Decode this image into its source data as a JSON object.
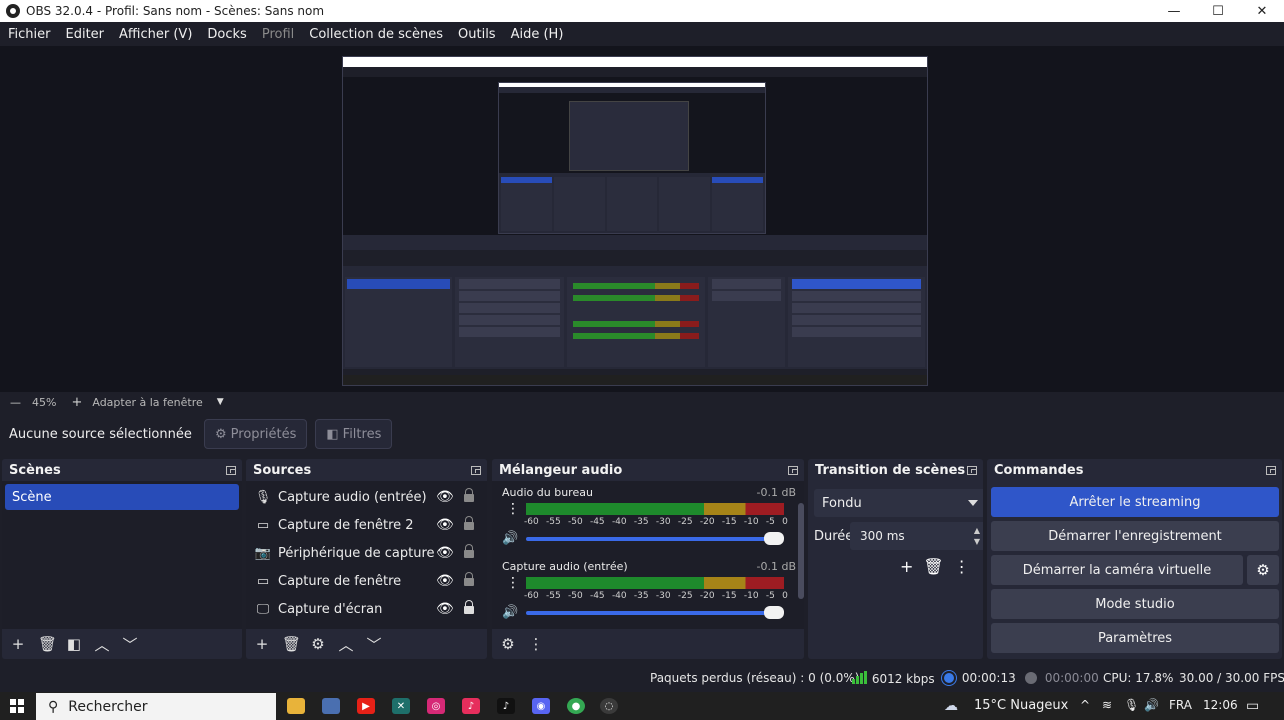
{
  "window": {
    "title": "OBS 32.0.4 - Profil: Sans nom - Scènes: Sans nom",
    "minimize": "—",
    "maximize": "☐",
    "close": "✕"
  },
  "menu": {
    "items": [
      "Fichier",
      "Editer",
      "Afficher (V)",
      "Docks",
      "Profil",
      "Collection de scènes",
      "Outils",
      "Aide (H)"
    ]
  },
  "zoom": {
    "minus": "—",
    "value": "45%",
    "plus": "+",
    "fit": "Adapter à la fenêtre"
  },
  "context": {
    "no_source": "Aucune source sélectionnée",
    "properties": "Propriétés",
    "filters": "Filtres"
  },
  "scenes": {
    "title": "Scènes",
    "items": [
      "Scène"
    ]
  },
  "sources": {
    "title": "Sources",
    "items": [
      {
        "name": "Capture audio (entrée)",
        "icon": "microphone-icon",
        "locked": false
      },
      {
        "name": "Capture de fenêtre 2",
        "icon": "window-icon",
        "locked": false
      },
      {
        "name": "Périphérique de capture vid",
        "icon": "camera-icon",
        "locked": false
      },
      {
        "name": "Capture de fenêtre",
        "icon": "window-icon",
        "locked": false
      },
      {
        "name": "Capture d'écran",
        "icon": "monitor-icon",
        "locked": true
      }
    ]
  },
  "mixer": {
    "title": "Mélangeur audio",
    "channels": [
      {
        "name": "Audio du bureau",
        "db": "-0.1 dB",
        "volume": 1.0
      },
      {
        "name": "Capture audio (entrée)",
        "db": "-0.1 dB",
        "volume": 1.0
      }
    ],
    "ticks": [
      "-60",
      "-55",
      "-50",
      "-45",
      "-40",
      "-35",
      "-30",
      "-25",
      "-20",
      "-15",
      "-10",
      "-5",
      "0"
    ]
  },
  "transition": {
    "title": "Transition de scènes",
    "selected": "Fondu",
    "duration_label": "Durée",
    "duration_value": "300 ms"
  },
  "commands": {
    "title": "Commandes",
    "stop_streaming": "Arrêter le streaming",
    "start_recording": "Démarrer l'enregistrement",
    "start_virtual_cam": "Démarrer la caméra virtuelle",
    "studio_mode": "Mode studio",
    "settings": "Paramètres"
  },
  "status": {
    "dropped": "Paquets perdus (réseau) : 0 (0.0%)",
    "bitrate": "6012 kbps",
    "stream_time": "00:00:13",
    "rec_time": "00:00:00",
    "cpu": "CPU: 17.8%",
    "fps": "30.00 / 30.00 FPS"
  },
  "taskbar": {
    "search": "Rechercher",
    "weather": "15°C  Nuageux",
    "lang": "FRA",
    "time": "12:06"
  },
  "colors": {
    "accent": "#284cb8",
    "stream_button": "#2f56c9",
    "panel": "#262837",
    "background": "#1e1f29"
  }
}
